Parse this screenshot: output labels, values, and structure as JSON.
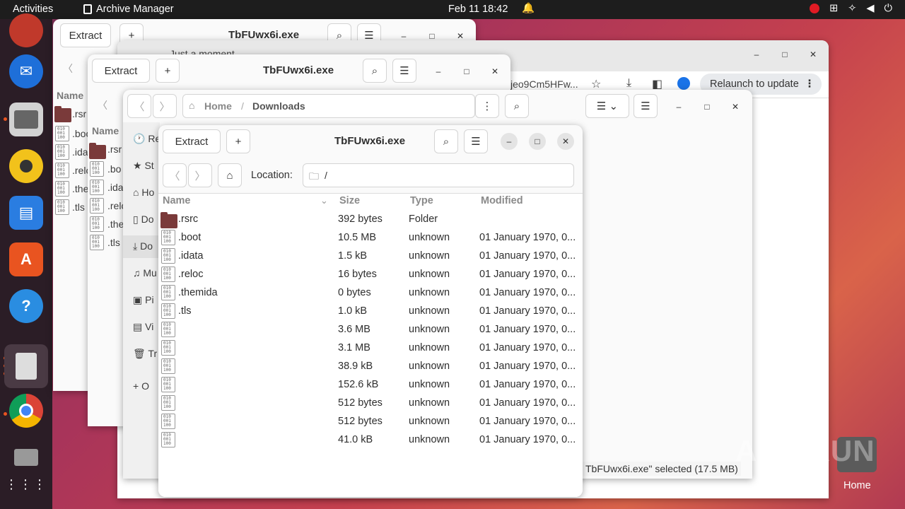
{
  "topbar": {
    "activities": "Activities",
    "app_name": "Archive Manager",
    "clock": "Feb 11  18:42"
  },
  "dock": {
    "items": [
      "ubuntu-icon",
      "thunderbird-icon",
      "files-icon",
      "rhythmbox-icon",
      "writer-icon",
      "software-icon",
      "help-icon",
      "archive-icon",
      "chrome-icon",
      "storage-icon",
      "apps-grid-icon"
    ]
  },
  "back_window_1": {
    "extract": "Extract",
    "title": "TbFUwx6i.exe",
    "col_name": "Name",
    "rows": [
      ".rsr",
      ".boo",
      ".ida",
      ".relo",
      ".the",
      ".tls"
    ]
  },
  "browser": {
    "tab": "Just a moment...",
    "url_partial": "jeo9Cm5HFw...",
    "relaunch": "Relaunch to update"
  },
  "back_window_2": {
    "extract": "Extract",
    "title": "TbFUwx6i.exe",
    "col_name": "Name",
    "rows": [
      ".rsr",
      ".bo",
      ".ida",
      ".relo",
      ".the",
      ".tls"
    ]
  },
  "files": {
    "breadcrumb_home": "Home",
    "breadcrumb_current": "Downloads",
    "sidebar": [
      "Re",
      "St",
      "Ho",
      "Do",
      "Do",
      "Mu",
      "Pi",
      "Vi",
      "Tr",
      "O"
    ],
    "status": "TbFUwx6i.exe\" selected  (17.5 MB)"
  },
  "archive": {
    "extract": "Extract",
    "title": "TbFUwx6i.exe",
    "location_label": "Location:",
    "location_value": "/",
    "columns": {
      "name": "Name",
      "size": "Size",
      "type": "Type",
      "modified": "Modified"
    },
    "rows": [
      {
        "name": ".rsrc",
        "size": "392 bytes",
        "type": "Folder",
        "modified": "",
        "folder": true
      },
      {
        "name": ".boot",
        "size": "10.5 MB",
        "type": "unknown",
        "modified": "01 January 1970, 0..."
      },
      {
        "name": ".idata",
        "size": "1.5 kB",
        "type": "unknown",
        "modified": "01 January 1970, 0..."
      },
      {
        "name": ".reloc",
        "size": "16 bytes",
        "type": "unknown",
        "modified": "01 January 1970, 0..."
      },
      {
        "name": ".themida",
        "size": "0 bytes",
        "type": "unknown",
        "modified": "01 January 1970, 0..."
      },
      {
        "name": ".tls",
        "size": "1.0 kB",
        "type": "unknown",
        "modified": "01 January 1970, 0..."
      },
      {
        "name": "",
        "size": "3.6 MB",
        "type": "unknown",
        "modified": "01 January 1970, 0..."
      },
      {
        "name": "",
        "size": "3.1 MB",
        "type": "unknown",
        "modified": "01 January 1970, 0..."
      },
      {
        "name": "",
        "size": "38.9 kB",
        "type": "unknown",
        "modified": "01 January 1970, 0..."
      },
      {
        "name": "",
        "size": "152.6 kB",
        "type": "unknown",
        "modified": "01 January 1970, 0..."
      },
      {
        "name": "",
        "size": "512 bytes",
        "type": "unknown",
        "modified": "01 January 1970, 0..."
      },
      {
        "name": "",
        "size": "512 bytes",
        "type": "unknown",
        "modified": "01 January 1970, 0..."
      },
      {
        "name": "",
        "size": "41.0 kB",
        "type": "unknown",
        "modified": "01 January 1970, 0..."
      }
    ]
  },
  "desktop": {
    "home_label": "Home",
    "watermark": "ANY RUN"
  }
}
